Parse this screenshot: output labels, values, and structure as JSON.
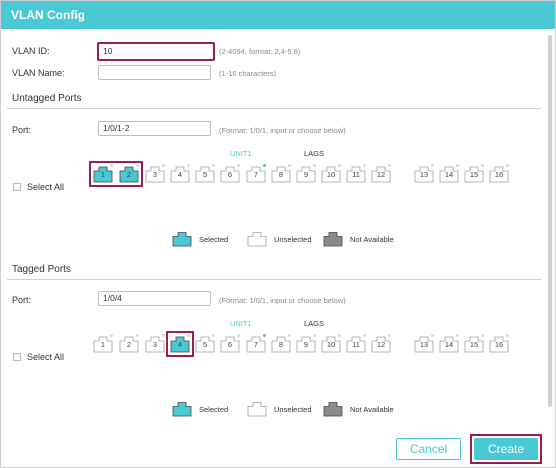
{
  "dialog": {
    "title": "VLAN Config"
  },
  "vlan": {
    "id_label": "VLAN ID:",
    "id_value": "10",
    "id_hint": "(2-4094, format: 2,4-5,8)",
    "name_label": "VLAN Name:",
    "name_value": "",
    "name_hint": "(1-16 characters)"
  },
  "untagged": {
    "title": "Untagged Ports",
    "port_label": "Port:",
    "port_value": "1/0/1-2",
    "port_hint": "(Format: 1/0/1, input or choose below)",
    "unit_label": "UNIT1",
    "lags_label": "LAGS",
    "select_all": "Select All",
    "ports": [
      "1",
      "2",
      "3",
      "4",
      "5",
      "6",
      "7",
      "8",
      "9",
      "10",
      "11",
      "12",
      "13",
      "14",
      "15",
      "16"
    ],
    "selected": [
      "1",
      "2"
    ]
  },
  "tagged": {
    "title": "Tagged Ports",
    "port_label": "Port:",
    "port_value": "1/0/4",
    "port_hint": "(Format: 1/0/1, input or choose below)",
    "unit_label": "UNIT1",
    "lags_label": "LAGS",
    "select_all": "Select All",
    "ports": [
      "1",
      "2",
      "3",
      "4",
      "5",
      "6",
      "7",
      "8",
      "9",
      "10",
      "11",
      "12",
      "13",
      "14",
      "15",
      "16"
    ],
    "selected": [
      "4"
    ]
  },
  "legend": {
    "selected": "Selected",
    "unselected": "Unselected",
    "not_available": "Not Available"
  },
  "buttons": {
    "cancel": "Cancel",
    "create": "Create"
  },
  "colors": {
    "accent": "#4ac9d4",
    "highlight": "#9c1d55",
    "not_available": "#8c8c8c"
  }
}
